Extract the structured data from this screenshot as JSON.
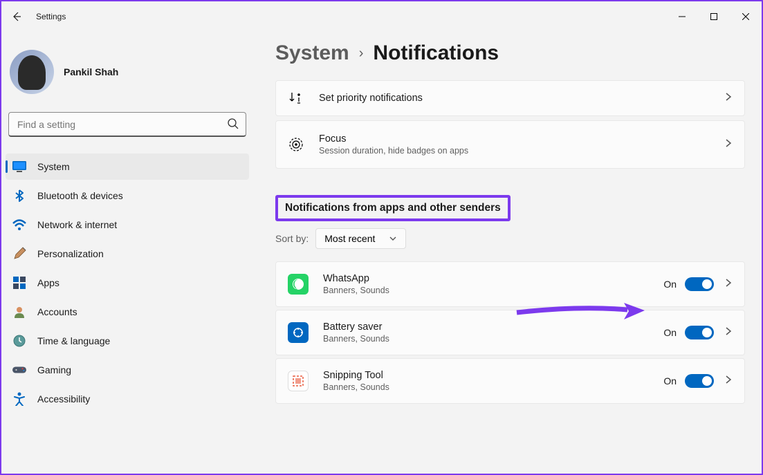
{
  "window": {
    "title": "Settings"
  },
  "user": {
    "name": "Pankil Shah"
  },
  "search": {
    "placeholder": "Find a setting"
  },
  "nav": [
    {
      "key": "system",
      "label": "System",
      "active": true
    },
    {
      "key": "bluetooth",
      "label": "Bluetooth & devices",
      "active": false
    },
    {
      "key": "network",
      "label": "Network & internet",
      "active": false
    },
    {
      "key": "personalization",
      "label": "Personalization",
      "active": false
    },
    {
      "key": "apps",
      "label": "Apps",
      "active": false
    },
    {
      "key": "accounts",
      "label": "Accounts",
      "active": false
    },
    {
      "key": "time",
      "label": "Time & language",
      "active": false
    },
    {
      "key": "gaming",
      "label": "Gaming",
      "active": false
    },
    {
      "key": "accessibility",
      "label": "Accessibility",
      "active": false
    }
  ],
  "breadcrumb": {
    "parent": "System",
    "current": "Notifications"
  },
  "cards": {
    "priority": {
      "title": "Set priority notifications"
    },
    "focus": {
      "title": "Focus",
      "subtitle": "Session duration, hide badges on apps"
    }
  },
  "section_title": "Notifications from apps and other senders",
  "sort": {
    "label": "Sort by:",
    "value": "Most recent"
  },
  "apps": [
    {
      "key": "whatsapp",
      "name": "WhatsApp",
      "detail": "Banners, Sounds",
      "state": "On",
      "color": "#25d366",
      "icon_bg": "#25d366"
    },
    {
      "key": "battery",
      "name": "Battery saver",
      "detail": "Banners, Sounds",
      "state": "On",
      "color": "#0067c0",
      "icon_bg": "#0067c0"
    },
    {
      "key": "snipping",
      "name": "Snipping Tool",
      "detail": "Banners, Sounds",
      "state": "On",
      "color": "#e85b3f",
      "icon_bg": "#e85b3f"
    }
  ]
}
